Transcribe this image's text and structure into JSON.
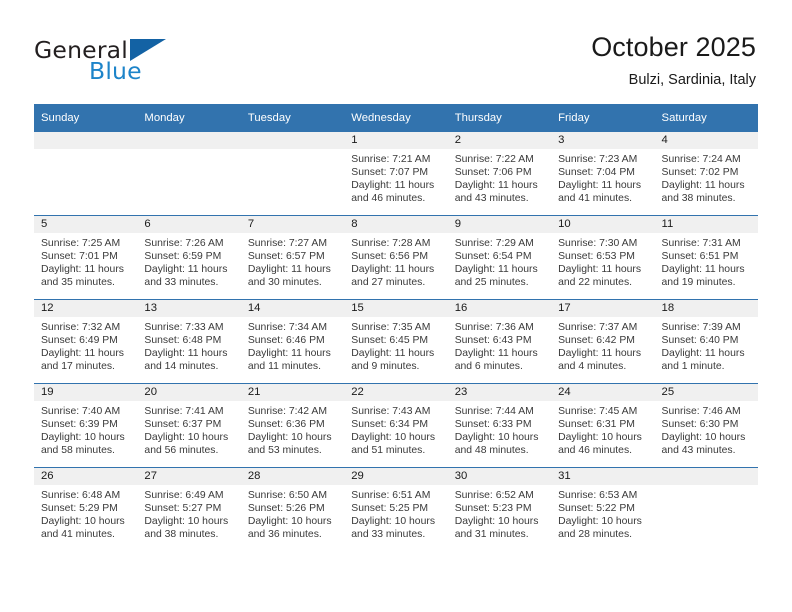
{
  "brand": {
    "name_top": "General",
    "name_bottom": "Blue",
    "mark": "triangle-logo",
    "accent_color": "#1d84c9"
  },
  "header": {
    "title": "October 2025",
    "location": "Bulzi, Sardinia, Italy"
  },
  "theme": {
    "header_bg": "#3273ae",
    "header_text": "#ffffff",
    "daynum_band_bg": "#f0f0f0",
    "grid_line": "#3273ae"
  },
  "weekdays": [
    "Sunday",
    "Monday",
    "Tuesday",
    "Wednesday",
    "Thursday",
    "Friday",
    "Saturday"
  ],
  "labels": {
    "sunrise": "Sunrise:",
    "sunset": "Sunset:",
    "daylight": "Daylight:"
  },
  "weeks": [
    [
      {
        "empty": true
      },
      {
        "empty": true
      },
      {
        "empty": true
      },
      {
        "day": "1",
        "sunrise": "Sunrise: 7:21 AM",
        "sunset": "Sunset: 7:07 PM",
        "daylight1": "Daylight: 11 hours",
        "daylight2": "and 46 minutes."
      },
      {
        "day": "2",
        "sunrise": "Sunrise: 7:22 AM",
        "sunset": "Sunset: 7:06 PM",
        "daylight1": "Daylight: 11 hours",
        "daylight2": "and 43 minutes."
      },
      {
        "day": "3",
        "sunrise": "Sunrise: 7:23 AM",
        "sunset": "Sunset: 7:04 PM",
        "daylight1": "Daylight: 11 hours",
        "daylight2": "and 41 minutes."
      },
      {
        "day": "4",
        "sunrise": "Sunrise: 7:24 AM",
        "sunset": "Sunset: 7:02 PM",
        "daylight1": "Daylight: 11 hours",
        "daylight2": "and 38 minutes."
      }
    ],
    [
      {
        "day": "5",
        "sunrise": "Sunrise: 7:25 AM",
        "sunset": "Sunset: 7:01 PM",
        "daylight1": "Daylight: 11 hours",
        "daylight2": "and 35 minutes."
      },
      {
        "day": "6",
        "sunrise": "Sunrise: 7:26 AM",
        "sunset": "Sunset: 6:59 PM",
        "daylight1": "Daylight: 11 hours",
        "daylight2": "and 33 minutes."
      },
      {
        "day": "7",
        "sunrise": "Sunrise: 7:27 AM",
        "sunset": "Sunset: 6:57 PM",
        "daylight1": "Daylight: 11 hours",
        "daylight2": "and 30 minutes."
      },
      {
        "day": "8",
        "sunrise": "Sunrise: 7:28 AM",
        "sunset": "Sunset: 6:56 PM",
        "daylight1": "Daylight: 11 hours",
        "daylight2": "and 27 minutes."
      },
      {
        "day": "9",
        "sunrise": "Sunrise: 7:29 AM",
        "sunset": "Sunset: 6:54 PM",
        "daylight1": "Daylight: 11 hours",
        "daylight2": "and 25 minutes."
      },
      {
        "day": "10",
        "sunrise": "Sunrise: 7:30 AM",
        "sunset": "Sunset: 6:53 PM",
        "daylight1": "Daylight: 11 hours",
        "daylight2": "and 22 minutes."
      },
      {
        "day": "11",
        "sunrise": "Sunrise: 7:31 AM",
        "sunset": "Sunset: 6:51 PM",
        "daylight1": "Daylight: 11 hours",
        "daylight2": "and 19 minutes."
      }
    ],
    [
      {
        "day": "12",
        "sunrise": "Sunrise: 7:32 AM",
        "sunset": "Sunset: 6:49 PM",
        "daylight1": "Daylight: 11 hours",
        "daylight2": "and 17 minutes."
      },
      {
        "day": "13",
        "sunrise": "Sunrise: 7:33 AM",
        "sunset": "Sunset: 6:48 PM",
        "daylight1": "Daylight: 11 hours",
        "daylight2": "and 14 minutes."
      },
      {
        "day": "14",
        "sunrise": "Sunrise: 7:34 AM",
        "sunset": "Sunset: 6:46 PM",
        "daylight1": "Daylight: 11 hours",
        "daylight2": "and 11 minutes."
      },
      {
        "day": "15",
        "sunrise": "Sunrise: 7:35 AM",
        "sunset": "Sunset: 6:45 PM",
        "daylight1": "Daylight: 11 hours",
        "daylight2": "and 9 minutes."
      },
      {
        "day": "16",
        "sunrise": "Sunrise: 7:36 AM",
        "sunset": "Sunset: 6:43 PM",
        "daylight1": "Daylight: 11 hours",
        "daylight2": "and 6 minutes."
      },
      {
        "day": "17",
        "sunrise": "Sunrise: 7:37 AM",
        "sunset": "Sunset: 6:42 PM",
        "daylight1": "Daylight: 11 hours",
        "daylight2": "and 4 minutes."
      },
      {
        "day": "18",
        "sunrise": "Sunrise: 7:39 AM",
        "sunset": "Sunset: 6:40 PM",
        "daylight1": "Daylight: 11 hours",
        "daylight2": "and 1 minute."
      }
    ],
    [
      {
        "day": "19",
        "sunrise": "Sunrise: 7:40 AM",
        "sunset": "Sunset: 6:39 PM",
        "daylight1": "Daylight: 10 hours",
        "daylight2": "and 58 minutes."
      },
      {
        "day": "20",
        "sunrise": "Sunrise: 7:41 AM",
        "sunset": "Sunset: 6:37 PM",
        "daylight1": "Daylight: 10 hours",
        "daylight2": "and 56 minutes."
      },
      {
        "day": "21",
        "sunrise": "Sunrise: 7:42 AM",
        "sunset": "Sunset: 6:36 PM",
        "daylight1": "Daylight: 10 hours",
        "daylight2": "and 53 minutes."
      },
      {
        "day": "22",
        "sunrise": "Sunrise: 7:43 AM",
        "sunset": "Sunset: 6:34 PM",
        "daylight1": "Daylight: 10 hours",
        "daylight2": "and 51 minutes."
      },
      {
        "day": "23",
        "sunrise": "Sunrise: 7:44 AM",
        "sunset": "Sunset: 6:33 PM",
        "daylight1": "Daylight: 10 hours",
        "daylight2": "and 48 minutes."
      },
      {
        "day": "24",
        "sunrise": "Sunrise: 7:45 AM",
        "sunset": "Sunset: 6:31 PM",
        "daylight1": "Daylight: 10 hours",
        "daylight2": "and 46 minutes."
      },
      {
        "day": "25",
        "sunrise": "Sunrise: 7:46 AM",
        "sunset": "Sunset: 6:30 PM",
        "daylight1": "Daylight: 10 hours",
        "daylight2": "and 43 minutes."
      }
    ],
    [
      {
        "day": "26",
        "sunrise": "Sunrise: 6:48 AM",
        "sunset": "Sunset: 5:29 PM",
        "daylight1": "Daylight: 10 hours",
        "daylight2": "and 41 minutes."
      },
      {
        "day": "27",
        "sunrise": "Sunrise: 6:49 AM",
        "sunset": "Sunset: 5:27 PM",
        "daylight1": "Daylight: 10 hours",
        "daylight2": "and 38 minutes."
      },
      {
        "day": "28",
        "sunrise": "Sunrise: 6:50 AM",
        "sunset": "Sunset: 5:26 PM",
        "daylight1": "Daylight: 10 hours",
        "daylight2": "and 36 minutes."
      },
      {
        "day": "29",
        "sunrise": "Sunrise: 6:51 AM",
        "sunset": "Sunset: 5:25 PM",
        "daylight1": "Daylight: 10 hours",
        "daylight2": "and 33 minutes."
      },
      {
        "day": "30",
        "sunrise": "Sunrise: 6:52 AM",
        "sunset": "Sunset: 5:23 PM",
        "daylight1": "Daylight: 10 hours",
        "daylight2": "and 31 minutes."
      },
      {
        "day": "31",
        "sunrise": "Sunrise: 6:53 AM",
        "sunset": "Sunset: 5:22 PM",
        "daylight1": "Daylight: 10 hours",
        "daylight2": "and 28 minutes."
      },
      {
        "empty": true
      }
    ]
  ]
}
